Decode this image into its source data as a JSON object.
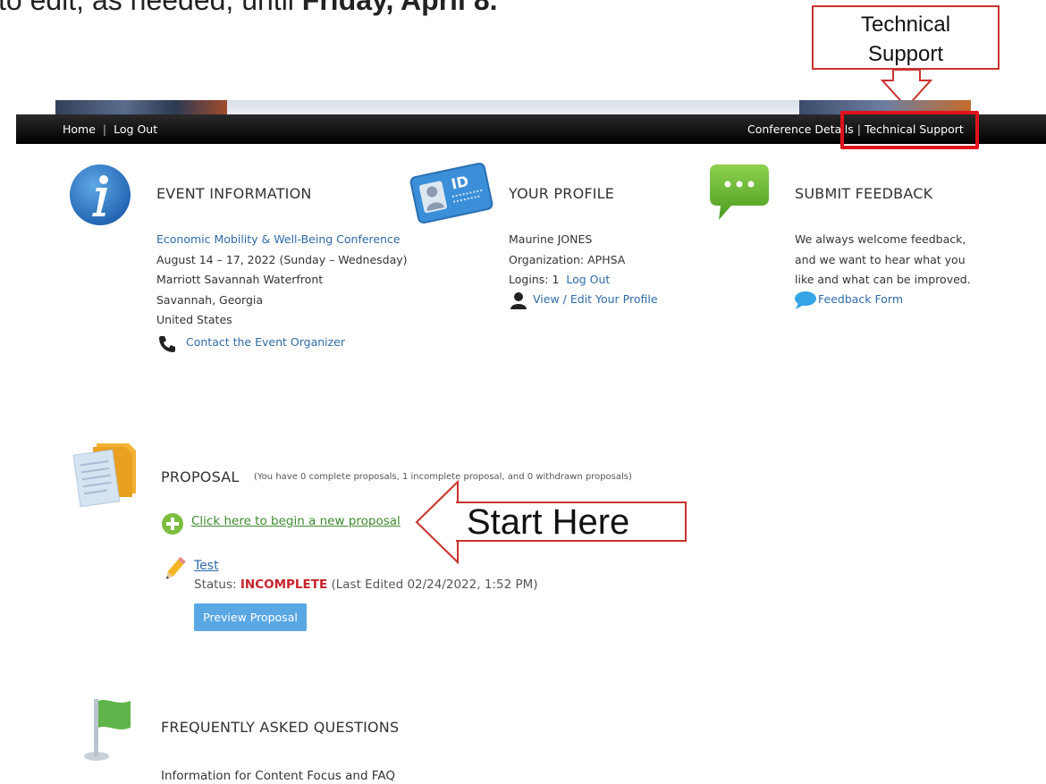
{
  "top_text": {
    "prefix": "to edit, as needed, until ",
    "bold": "Friday, April 8."
  },
  "callout_tech": {
    "line1": "Technical",
    "line2": "Support"
  },
  "nav": {
    "home": "Home",
    "logout": "Log Out",
    "conference_details": "Conference Details",
    "technical_support": "Technical Support"
  },
  "event": {
    "heading": "EVENT INFORMATION",
    "name": "Economic Mobility & Well-Being Conference",
    "dates": "August 14 – 17, 2022 (Sunday – Wednesday)",
    "venue": "Marriott Savannah Waterfront",
    "city": "Savannah, Georgia",
    "country": "United States",
    "contact": "Contact the Event Organizer"
  },
  "profile": {
    "heading": "YOUR PROFILE",
    "name": "Maurine JONES",
    "org_label": "Organization:",
    "org_value": "APHSA",
    "logins_label": "Logins:",
    "logins_value": "1",
    "logout": "Log Out",
    "view_edit": "View / Edit Your Profile"
  },
  "feedback": {
    "heading": "SUBMIT FEEDBACK",
    "line1": "We always welcome feedback,",
    "line2": "and we want to hear what you",
    "line3": "like and what can be improved.",
    "form": "Feedback Form"
  },
  "proposal": {
    "heading": "PROPOSAL",
    "summary": "(You have 0 complete proposals, 1 incomplete proposal, and 0 withdrawn proposals)",
    "new_link": "Click here to begin a new proposal",
    "item_title": "Test",
    "status_label": "Status:",
    "status_value": "INCOMPLETE",
    "last_edited": "(Last Edited 02/24/2022, 1:52 PM)",
    "preview_button": "Preview Proposal"
  },
  "start_callout": "Start Here",
  "faq": {
    "heading": "FREQUENTLY ASKED QUESTIONS",
    "info": "Information for Content Focus and FAQ"
  },
  "colors": {
    "link_blue": "#2e6aa8",
    "status_red": "#c8222a",
    "button_blue": "#59a7e3",
    "highlight_red": "#e0131b",
    "link_green": "#3f8a2e"
  }
}
